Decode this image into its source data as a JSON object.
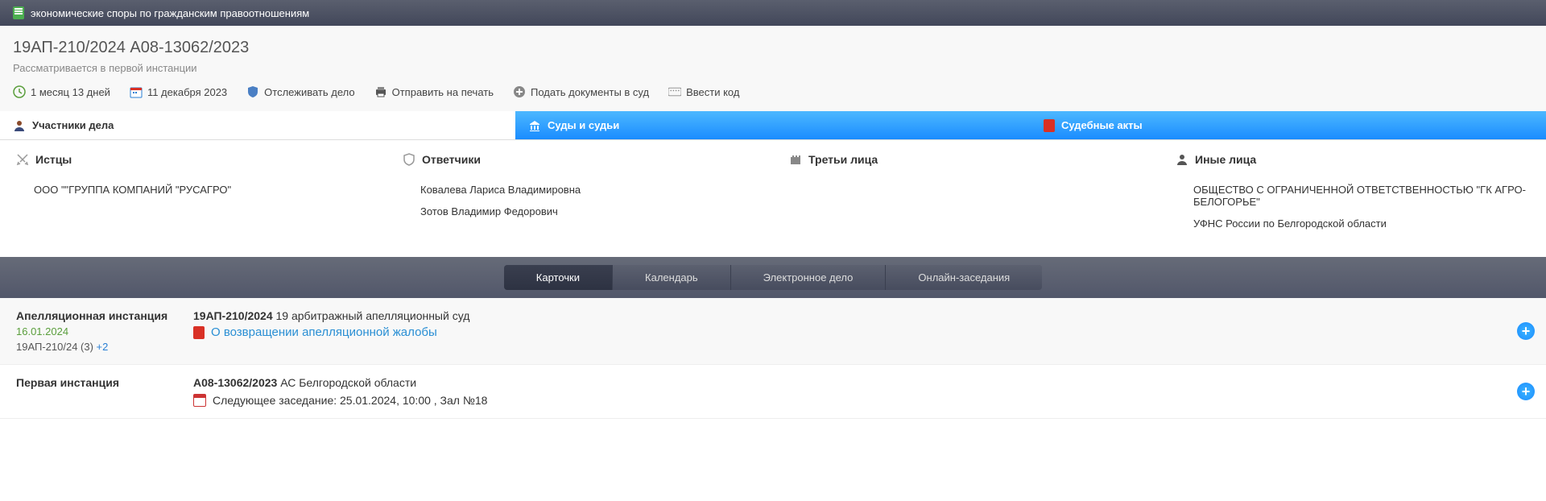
{
  "header": {
    "title": "экономические споры по гражданским правоотношениям"
  },
  "case": {
    "numbers": "19АП-210/2024    А08-13062/2023",
    "status": "Рассматривается в первой инстанции"
  },
  "actions": {
    "duration": "1 месяц 13 дней",
    "date": "11 декабря 2023",
    "track": "Отслеживать дело",
    "print": "Отправить на печать",
    "submit": "Подать документы в суд",
    "code": "Ввести код"
  },
  "tabs": {
    "participants": "Участники дела",
    "courts": "Суды и судьи",
    "acts": "Судебные акты"
  },
  "participants": {
    "plaintiffs": {
      "label": "Истцы",
      "items": [
        "ООО \"\"ГРУППА КОМПАНИЙ \"РУСАГРО\""
      ]
    },
    "defendants": {
      "label": "Ответчики",
      "items": [
        "Ковалева Лариса Владимировна",
        "Зотов Владимир Федорович"
      ]
    },
    "third": {
      "label": "Третьи лица",
      "items": []
    },
    "other": {
      "label": "Иные лица",
      "items": [
        "ОБЩЕСТВО С ОГРАНИЧЕННОЙ ОТВЕТСТВЕННОСТЬЮ \"ГК АГРО-БЕЛОГОРЬЕ\"",
        "УФНС России по Белгородской области"
      ]
    }
  },
  "toolbar": {
    "cards": "Карточки",
    "calendar": "Календарь",
    "ecase": "Электронное дело",
    "online": "Онлайн-заседания"
  },
  "instances": [
    {
      "title": "Апелляционная инстанция",
      "date": "16.01.2024",
      "ref": "19АП-210/24 (3) ",
      "refExtra": "+2",
      "caseNo": "19АП-210/2024",
      "court": " 19 арбитражный апелляционный суд",
      "doc": "О возвращении апелляционной жалобы"
    },
    {
      "title": "Первая инстанция",
      "caseNo": "А08-13062/2023",
      "court": " АС Белгородской области",
      "next": "Следующее заседание: 25.01.2024, 10:00 , Зал №18"
    }
  ]
}
